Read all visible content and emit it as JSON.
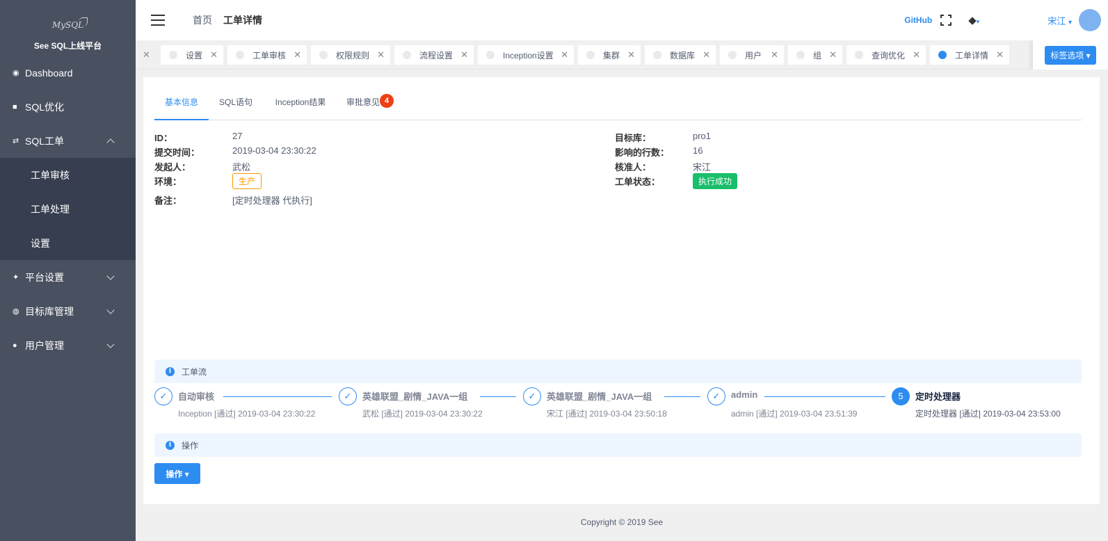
{
  "sidebar": {
    "logo_text": "MySQL",
    "title": "See SQL上线平台",
    "items": [
      {
        "label": "Dashboard",
        "icon": "eye-icon"
      },
      {
        "label": "SQL优化",
        "icon": "cube-icon"
      },
      {
        "label": "SQL工单",
        "icon": "shuffle-icon",
        "expanded": true
      },
      {
        "label": "平台设置",
        "icon": "wrench-icon"
      },
      {
        "label": "目标库管理",
        "icon": "globe-icon"
      },
      {
        "label": "用户管理",
        "icon": "person-icon"
      }
    ],
    "sub_items": [
      {
        "label": "工单审核"
      },
      {
        "label": "工单处理"
      },
      {
        "label": "设置"
      }
    ]
  },
  "header": {
    "breadcrumb_home": "首页",
    "breadcrumb_current": "工单详情",
    "github": "GitHub",
    "user": "宋江",
    "caret": "▾"
  },
  "tags": {
    "items": [
      {
        "label": "设置"
      },
      {
        "label": "工单审核"
      },
      {
        "label": "权限规则"
      },
      {
        "label": "流程设置"
      },
      {
        "label": "Inception设置"
      },
      {
        "label": "集群"
      },
      {
        "label": "数据库"
      },
      {
        "label": "用户"
      },
      {
        "label": "组"
      },
      {
        "label": "查询优化"
      },
      {
        "label": "工单详情",
        "active": true
      }
    ],
    "options_label": "标签选项 ▾"
  },
  "tabs": [
    {
      "label": "基本信息",
      "active": true
    },
    {
      "label": "SQL语句"
    },
    {
      "label": "Inception结果"
    },
    {
      "label": "审批意见",
      "badge": "4"
    }
  ],
  "info": {
    "left": [
      {
        "label": "ID：",
        "value": "27"
      },
      {
        "label": "提交时间：",
        "value": "2019-03-04 23:30:22"
      },
      {
        "label": "发起人：",
        "value": "武松"
      },
      {
        "label": "环境：",
        "value": "生产"
      },
      {
        "label": "备注：",
        "value": "[定时处理器 代执行]"
      }
    ],
    "right": [
      {
        "label": "目标库：",
        "value": "pro1"
      },
      {
        "label": "影响的行数：",
        "value": "16"
      },
      {
        "label": "核准人：",
        "value": "宋江"
      },
      {
        "label": "工单状态：",
        "value": "执行成功"
      }
    ]
  },
  "workflow": {
    "section_title": "工单流",
    "steps": [
      {
        "title": "自动审核",
        "desc": "Inception [通过] 2019-03-04 23:30:22",
        "state": "done"
      },
      {
        "title": "英雄联盟_剧情_JAVA一组",
        "desc": "武松 [通过] 2019-03-04 23:30:22",
        "state": "done"
      },
      {
        "title": "英雄联盟_剧情_JAVA一组",
        "desc": "宋江 [通过] 2019-03-04 23:50:18",
        "state": "done"
      },
      {
        "title": "admin",
        "desc": "admin [通过] 2019-03-04 23:51:39",
        "state": "done"
      },
      {
        "title": "定时处理器",
        "desc": "定时处理器 [通过] 2019-03-04 23:53:00",
        "state": "current",
        "number": "5"
      }
    ],
    "check_mark": "✓"
  },
  "operations": {
    "section_title": "操作",
    "button_label": "操作 ▾"
  },
  "footer": {
    "copyright": "Copyright © 2019 See"
  },
  "colors": {
    "primary": "#2d8cf0",
    "sidebar_bg": "#495060",
    "submenu_bg": "#363e4f",
    "success": "#19be6b",
    "warning": "#ff9900",
    "error": "#ed4014"
  }
}
